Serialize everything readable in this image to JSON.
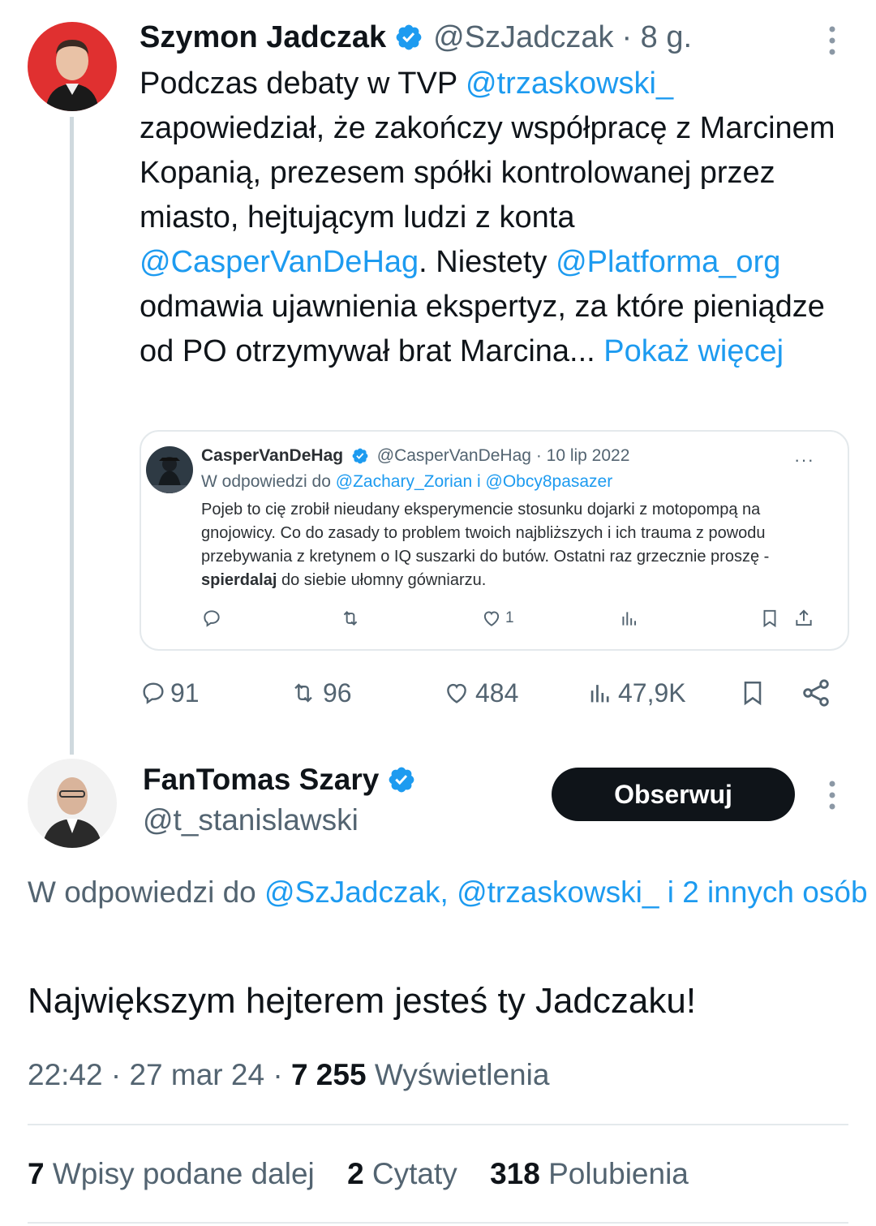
{
  "colors": {
    "accent": "#1d9bf0",
    "text": "#0f1419",
    "muted": "#536471",
    "border": "#e4e9ec"
  },
  "parent": {
    "name": "Szymon Jadczak",
    "handle": "@SzJadczak",
    "time": "· 8 g.",
    "text": {
      "p1": "Podczas debaty w TVP ",
      "m1": "@trzaskowski_",
      "p2": " zapowiedział, że zakończy współpracę z Marcinem Kopanią, prezesem spółki kontrolowanej przez miasto, hejtującym ludzi z konta ",
      "m2": "@CasperVanDeHag",
      "p3": ". Niestety ",
      "m3": "@Platforma_org",
      "p4": " odmawia ujawnienia ekspertyz, za które pieniądze od PO otrzymywał brat Marcina... ",
      "show_more": "Pokaż więcej"
    },
    "quote": {
      "name": "CasperVanDeHag",
      "handle": "@CasperVanDeHag",
      "date": "· 10 lip 2022",
      "more": "···",
      "reply_prefix": "W odpowiedzi do ",
      "reply_user1": "@Zachary_Zorian",
      "reply_sep": " i ",
      "reply_user2": "@Obcy8pasazer",
      "text_a": "Pojeb to cię zrobił nieudany eksperymencie stosunku dojarki z motopompą na gnojowicy. Co do zasady to problem twoich najbliższych i ich trauma z powodu przebywania z kretynem o IQ suszarki do butów. Ostatni raz grzecznie proszę - ",
      "text_bold": "spierdalaj",
      "text_b": " do siebie ułomny gówniarzu.",
      "likes": "1"
    },
    "actions": {
      "replies": "91",
      "reposts": "96",
      "likes": "484",
      "views": "47,9K"
    }
  },
  "reply": {
    "name": "FanTomas Szary",
    "handle": "@t_stanislawski",
    "follow_label": "Obserwuj",
    "replying_prefix": "W odpowiedzi do ",
    "replying_users": "@SzJadczak, @trzaskowski_ i 2 innych osób",
    "text": "Największym hejterem jesteś ty Jadczaku!",
    "time": "22:42 · 27 mar 24 · ",
    "views_count": "7 255",
    "views_label": " Wyświetlenia",
    "reposts_count": "7",
    "reposts_label": " Wpisy podane dalej",
    "quotes_count": "2",
    "quotes_label": " Cytaty",
    "likes_count": "318",
    "likes_label": " Polubienia"
  }
}
